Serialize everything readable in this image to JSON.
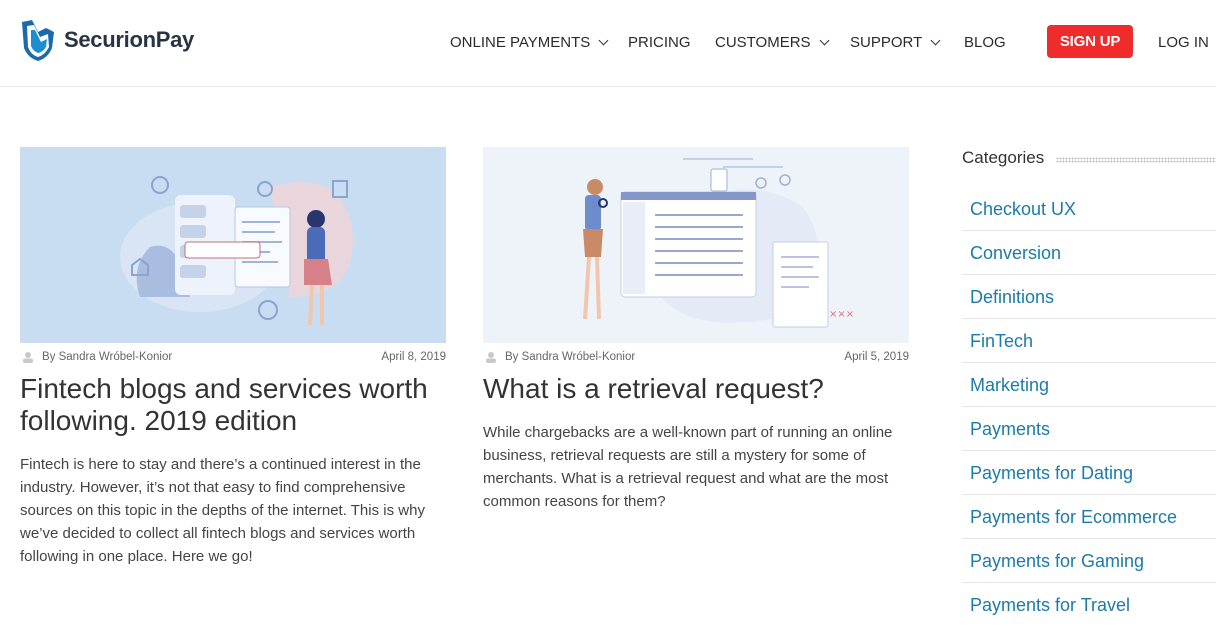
{
  "brand": {
    "name": "SecurionPay"
  },
  "nav": {
    "items": [
      {
        "label": "ONLINE PAYMENTS",
        "dropdown": true
      },
      {
        "label": "PRICING",
        "dropdown": false
      },
      {
        "label": "CUSTOMERS",
        "dropdown": true
      },
      {
        "label": "SUPPORT",
        "dropdown": true
      },
      {
        "label": "BLOG",
        "dropdown": false
      }
    ],
    "signup_label": "SIGN UP",
    "login_label": "LOG IN"
  },
  "posts": [
    {
      "author": "By Sandra Wróbel-Konior",
      "date": "April 8, 2019",
      "title": "Fintech blogs and services worth following. 2019 edition",
      "excerpt": "Fintech is here to stay and there’s a continued interest in the industry. However, it’s not that easy to find comprehensive sources on this topic in the depths of the internet. This is why we’ve decided to collect all fintech blogs and services worth following in one place. Here we go!"
    },
    {
      "author": "By Sandra Wróbel-Konior",
      "date": "April 5, 2019",
      "title": "What is a retrieval request?",
      "excerpt": "While chargebacks are a well-known part of running an online business, retrieval requests are still a mystery for some of merchants. What is a retrieval request and what are the most common reasons for them?"
    }
  ],
  "sidebar": {
    "title": "Categories",
    "categories": [
      "Checkout UX",
      "Conversion",
      "Definitions",
      "FinTech",
      "Marketing",
      "Payments",
      "Payments for Dating",
      "Payments for Ecommerce",
      "Payments for Gaming",
      "Payments for Travel"
    ]
  },
  "colors": {
    "accent_red": "#ef2b2b",
    "link_blue": "#1c7ba8",
    "post1_bg": "#c8dcf2",
    "post2_bg": "#eef3fa"
  }
}
